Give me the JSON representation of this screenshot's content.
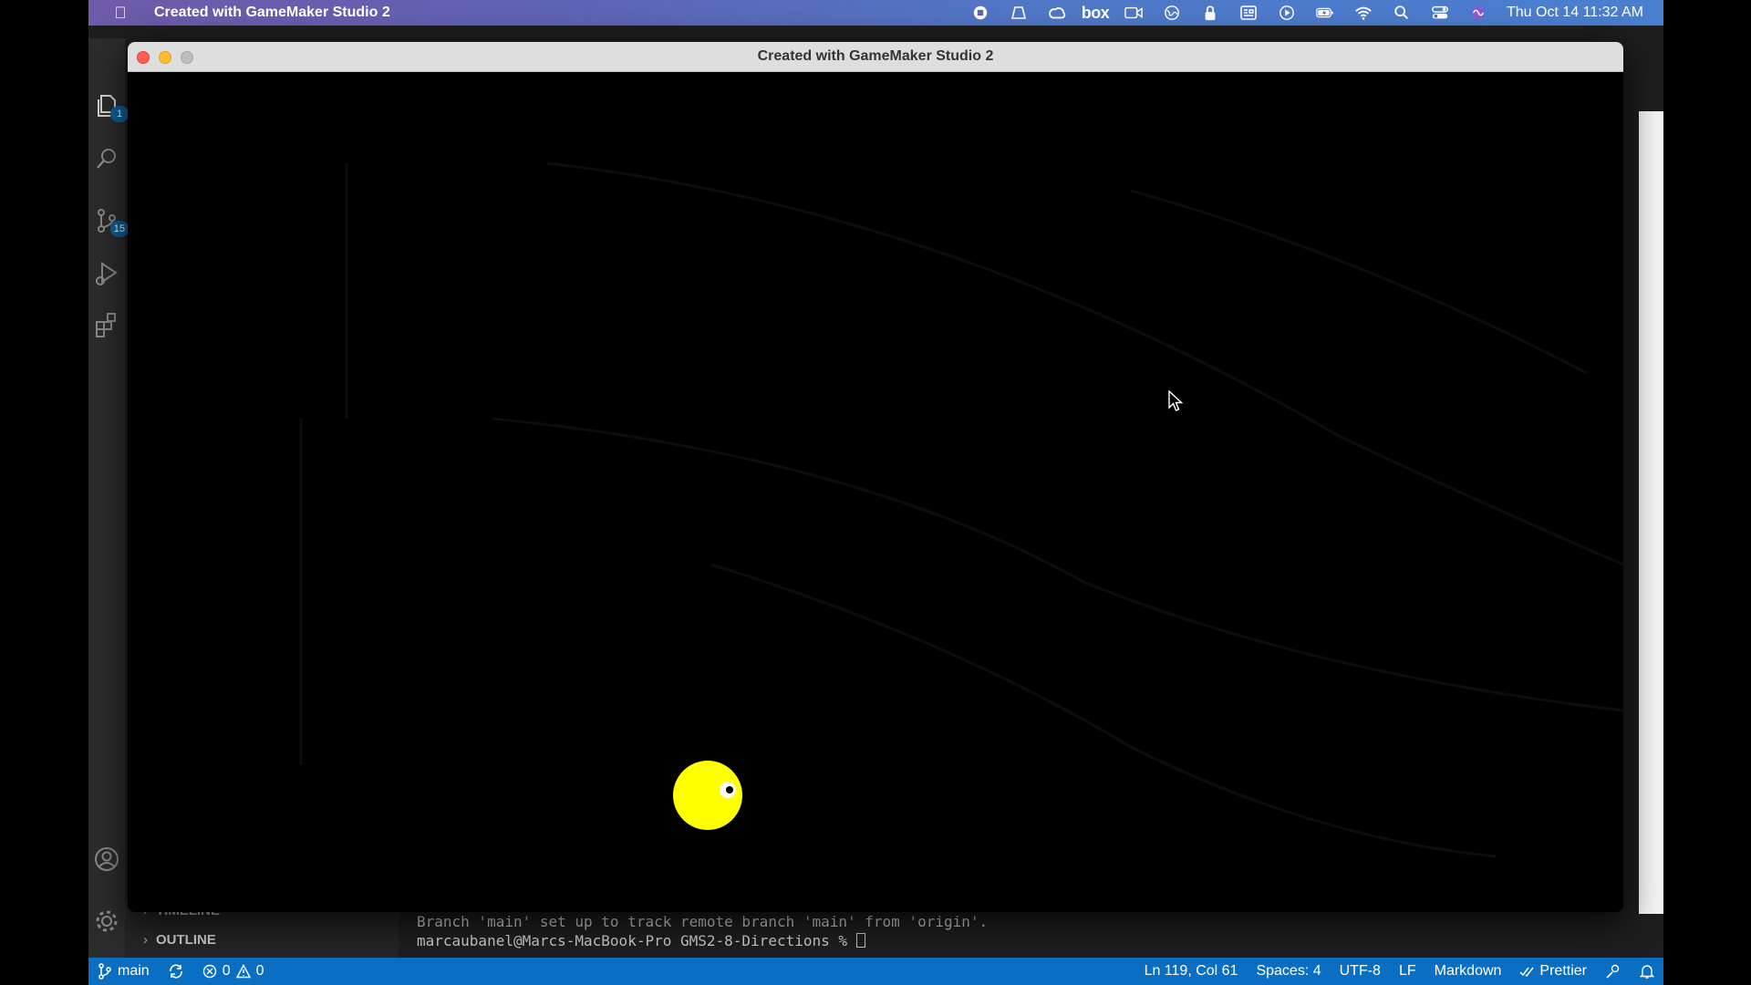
{
  "menubar": {
    "app_name": "Created with GameMaker Studio 2",
    "box_label": "box",
    "clock": "Thu Oct 14  11:32 AM"
  },
  "vscode": {
    "activity_badges": {
      "explorer": "1",
      "source_control": "15"
    },
    "sections": {
      "timeline": "TIMELINE",
      "outline": "OUTLINE"
    },
    "terminal": {
      "line1": "Branch 'main' set up to track remote branch 'main' from 'origin'.",
      "line2": "marcaubanel@Marcs-MacBook-Pro GMS2-8-Directions % "
    },
    "status": {
      "branch": "main",
      "errors": "0",
      "warnings": "0",
      "position": "Ln 119, Col 61",
      "spaces": "Spaces: 4",
      "encoding": "UTF-8",
      "eol": "LF",
      "language": "Markdown",
      "formatter": "Prettier"
    }
  },
  "game_window": {
    "title": "Created with GameMaker Studio 2",
    "player_color": "#ffff00"
  }
}
